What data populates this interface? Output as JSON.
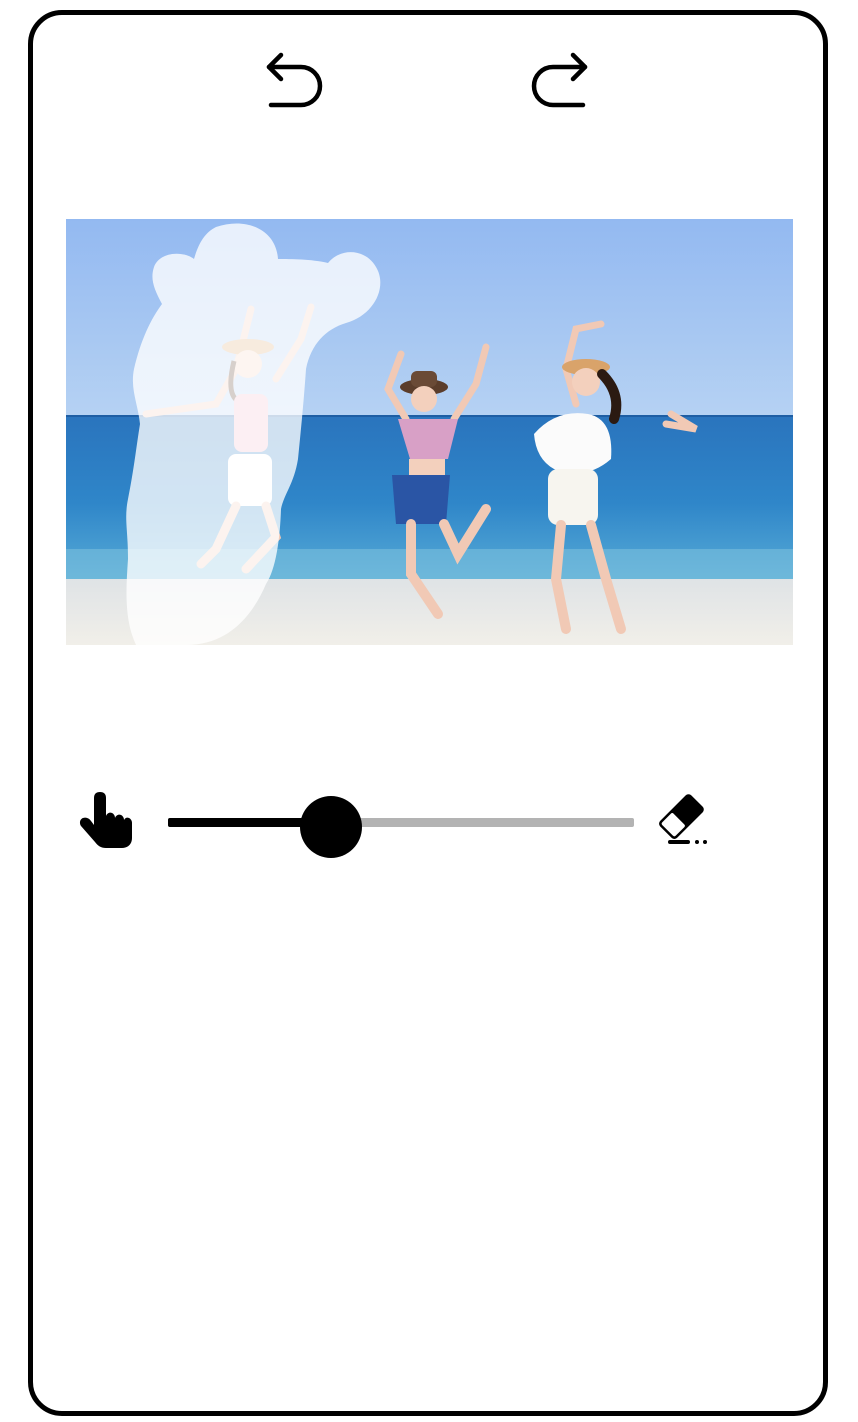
{
  "toolbar": {
    "undo_icon": "undo-icon",
    "redo_icon": "redo-icon"
  },
  "canvas": {
    "photo": "beach-photo-three-women-jumping",
    "mask_color": "#ffffff"
  },
  "brush": {
    "left_tool_icon": "hand-pointer-icon",
    "right_tool_icon": "eraser-icon",
    "size_fraction": 0.35,
    "track_color": "#b3b3b3",
    "fill_color": "#000000",
    "thumb_color": "#000000"
  },
  "colors": {
    "frame": "#000000",
    "background": "#ffffff",
    "sky": "#9cc2f0",
    "sea": "#2f7fc4",
    "sand": "#e8e6df"
  }
}
